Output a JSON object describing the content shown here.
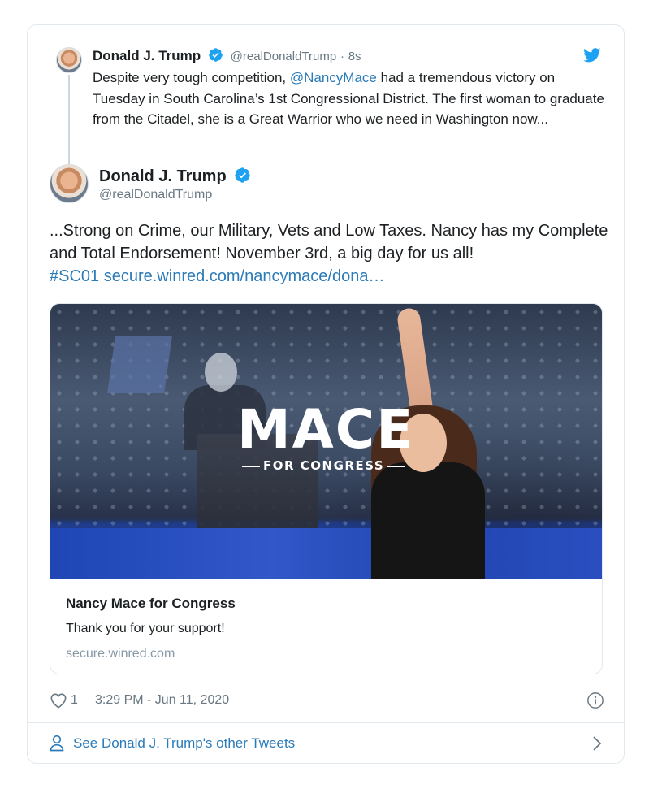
{
  "parent_tweet": {
    "name": "Donald J. Trump",
    "handle": "@realDonaldTrump",
    "separator": "·",
    "time": "8s",
    "text_before": "Despite very tough competition, ",
    "mention": "@NancyMace",
    "text_after": " had a tremendous victory on Tuesday in South Carolina’s 1st Congressional District. The first woman to graduate from the Citadel, she is a Great Warrior who we need in Washington now..."
  },
  "main_tweet": {
    "name": "Donald J. Trump",
    "handle": "@realDonaldTrump",
    "text": "...Strong on Crime, our Military, Vets and Low Taxes. Nancy has my Complete and Total Endorsement! November 3rd, a big day for us all!",
    "hashtag": "#SC01",
    "link": "secure.winred.com/nancymace/dona…"
  },
  "link_card": {
    "image_logo_title": "MACE",
    "image_logo_subtitle": "FOR CONGRESS",
    "title": "Nancy Mace for Congress",
    "description": "Thank you for your support!",
    "domain": "secure.winred.com"
  },
  "footer": {
    "likes": "1",
    "timestamp": "3:29 PM - Jun 11, 2020"
  },
  "more_tweets": {
    "label": "See Donald J. Trump's other Tweets"
  },
  "colors": {
    "link": "#2b7bb9",
    "verified": "#1da1f2",
    "secondary_text": "#697882",
    "border": "#e1e8ed"
  },
  "icons": [
    "verified-badge-icon",
    "twitter-bird-icon",
    "heart-icon",
    "info-icon",
    "person-icon",
    "chevron-right-icon"
  ]
}
